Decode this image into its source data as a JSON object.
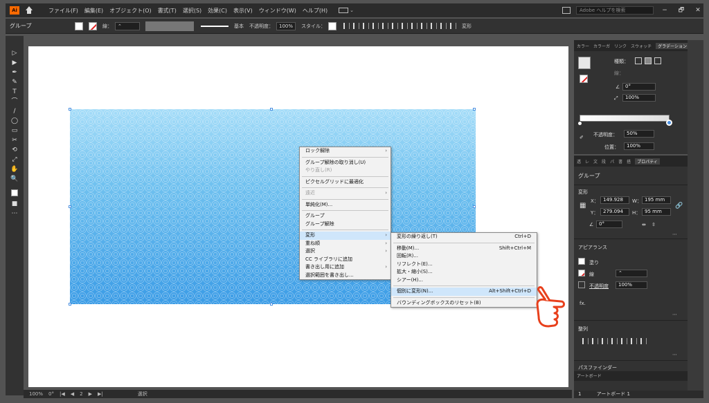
{
  "app": {
    "logo": "Ai",
    "menus": [
      "ファイル(F)",
      "編集(E)",
      "オブジェクト(O)",
      "書式(T)",
      "選択(S)",
      "効果(C)",
      "表示(V)",
      "ウィンドウ(W)",
      "ヘルプ(H)"
    ],
    "help_search_placeholder": "Adobe ヘルプを検索",
    "window_buttons": [
      "−",
      "🗗",
      "✕"
    ]
  },
  "control_bar": {
    "selection_label": "グループ",
    "stroke_label": "線：",
    "stroke_style": "基本",
    "opacity_label": "不透明度：",
    "opacity_value": "100%",
    "style_label": "スタイル：",
    "transform_label": "変形"
  },
  "tools": [
    "▷",
    "▶",
    "✒",
    "✎",
    "T",
    "⌒",
    "/",
    "◯",
    "▭",
    "✂",
    "⟲",
    "⤢",
    "✋",
    "🔍",
    "■",
    "⋯"
  ],
  "context_menu": {
    "items": [
      {
        "label": "ロック解除",
        "submenu": true
      },
      {
        "sep": true
      },
      {
        "label": "グループ解除の取り消し(U)"
      },
      {
        "label": "やり直し(R)",
        "disabled": true
      },
      {
        "sep": true
      },
      {
        "label": "ピクセルグリッドに最適化"
      },
      {
        "sep": true
      },
      {
        "label": "遠近",
        "disabled": true,
        "submenu": true
      },
      {
        "sep": true
      },
      {
        "label": "単純化(M)..."
      },
      {
        "sep": true
      },
      {
        "label": "グループ"
      },
      {
        "label": "グループ解除"
      },
      {
        "sep": true
      },
      {
        "label": "変形",
        "submenu": true,
        "highlight": true
      },
      {
        "label": "重ね順",
        "submenu": true
      },
      {
        "label": "選択",
        "submenu": true
      },
      {
        "label": "CC ライブラリに追加"
      },
      {
        "label": "書き出し用に追加",
        "submenu": true
      },
      {
        "label": "選択範囲を書き出し..."
      }
    ]
  },
  "transform_submenu": {
    "items": [
      {
        "label": "変形の繰り返し(T)",
        "shortcut": "Ctrl+D"
      },
      {
        "sep": true
      },
      {
        "label": "移動(M)...",
        "shortcut": "Shift+Ctrl+M"
      },
      {
        "label": "回転(R)..."
      },
      {
        "label": "リフレクト(E)..."
      },
      {
        "label": "拡大・縮小(S)..."
      },
      {
        "label": "シアー(H)..."
      },
      {
        "sep": true
      },
      {
        "label": "個別に変形(N)...",
        "shortcut": "Alt+Shift+Ctrl+D",
        "highlight": true
      },
      {
        "sep": true
      },
      {
        "label": "バウンディングボックスのリセット(B)"
      }
    ]
  },
  "gradient_panel": {
    "tabs": [
      "カラー",
      "カラーガ",
      "リンク",
      "スウォッチ",
      "グラデーション"
    ],
    "type_label": "種類：",
    "stroke_label": "線：",
    "angle_value": "0°",
    "ratio_value": "100%",
    "opacity_label": "不透明度：",
    "opacity_value": "50%",
    "position_label": "位置：",
    "position_value": "100%"
  },
  "properties_panel": {
    "tabs": [
      "透",
      "レ",
      "文",
      "段",
      "パ",
      "書",
      "搭",
      "プロパティ"
    ],
    "selection": "グループ",
    "transform_header": "変形",
    "x_label": "X：",
    "x_value": "149.928",
    "y_label": "Y：",
    "y_value": "279.094",
    "w_label": "W：",
    "w_value": "195 mm",
    "h_label": "H：",
    "h_value": "95 mm",
    "rotate_value": "0°",
    "appearance_header": "アピアランス",
    "fill_label": "塗り",
    "stroke_label": "線",
    "opacity_label": "不透明度",
    "opacity_value": "100%",
    "fx_label": "fx.",
    "align_header": "整列",
    "pathfinder_header": "パスファインダー",
    "artboard_header": "アートボード",
    "artboard_row_index": "1",
    "artboard_row_name": "アートボード 1"
  },
  "status_bar": {
    "zoom": "100%",
    "rotation": "0°",
    "artboard_nav": "2",
    "tool_name": "選択"
  },
  "colors": {
    "accent": "#4a8fe0",
    "menu_highlight": "#cfe6fb",
    "hand": "#e8401c"
  }
}
